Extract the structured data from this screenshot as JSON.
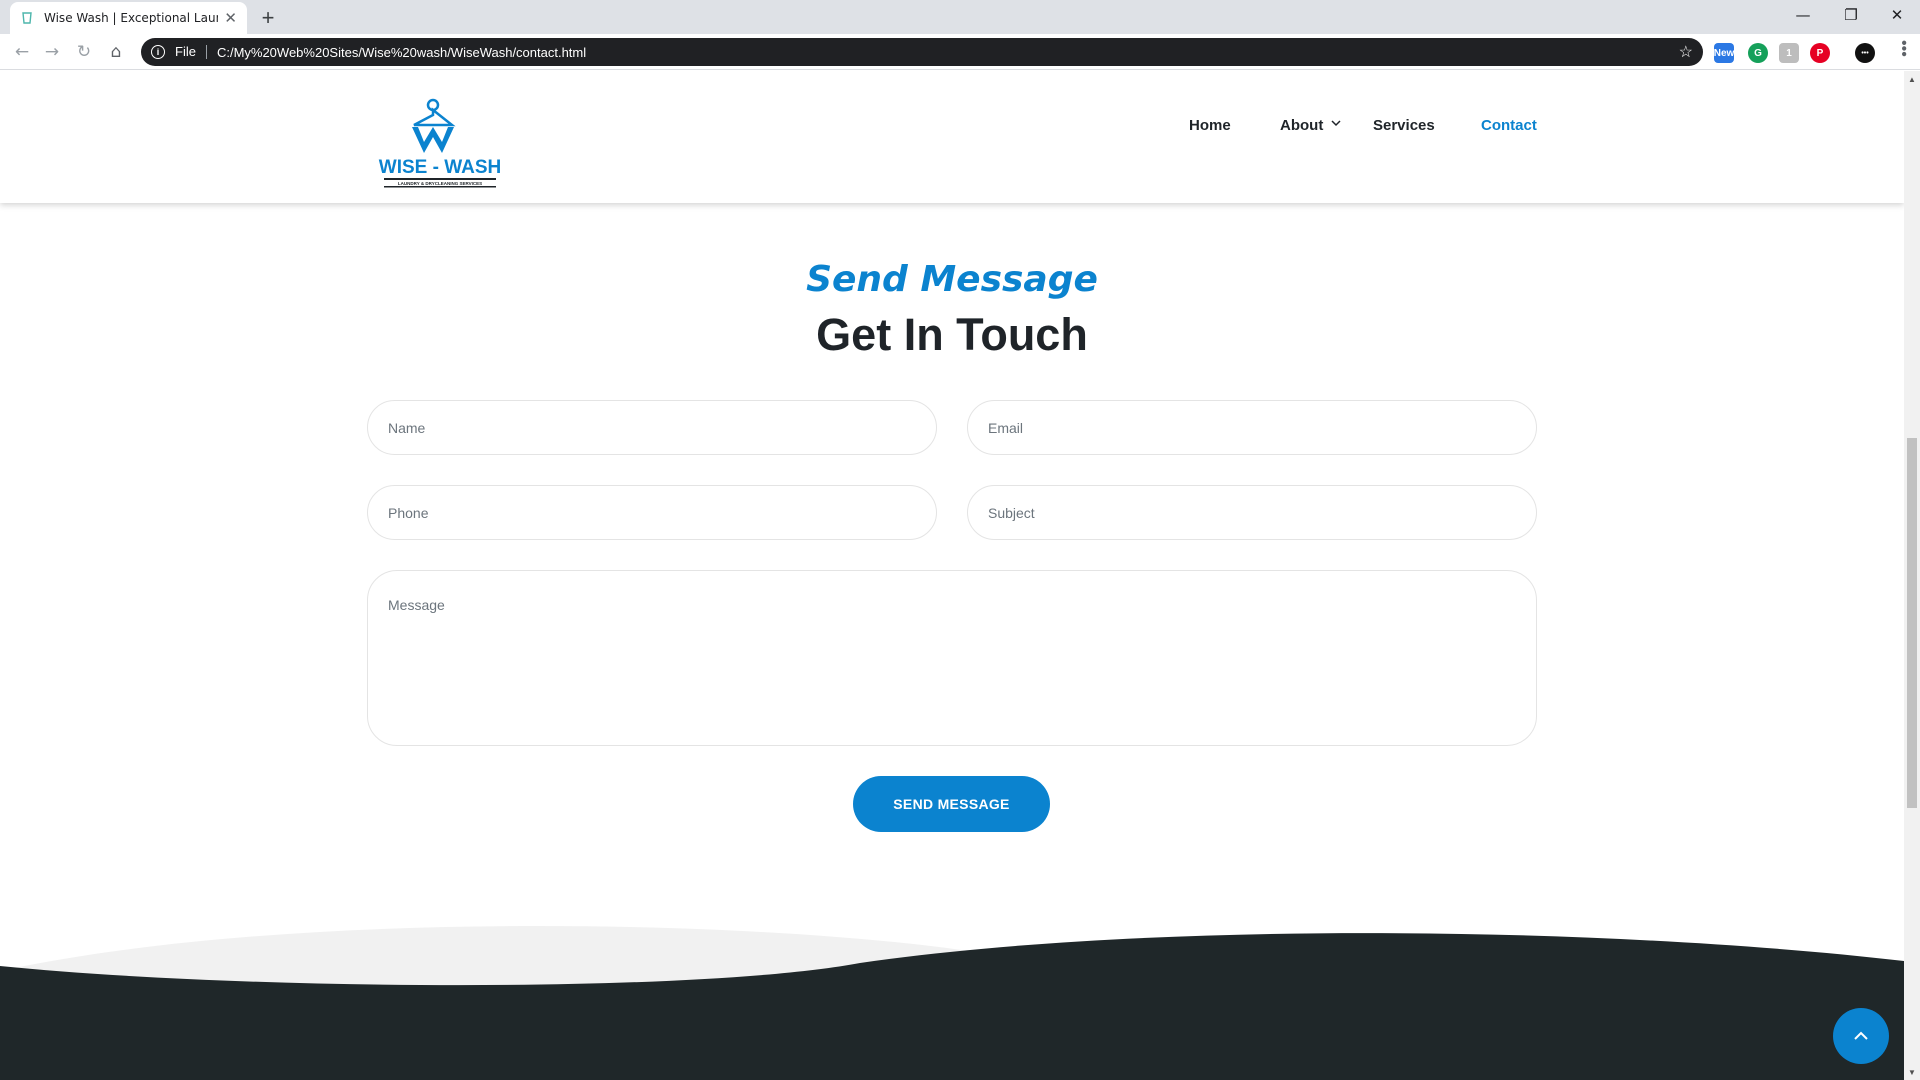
{
  "browser": {
    "tab_title": "Wise Wash | Exceptional Laundry",
    "tab_close": "✕",
    "new_tab": "+",
    "window_controls": {
      "minimize": "—",
      "restore": "❐",
      "close": "✕"
    },
    "nav": {
      "back": "←",
      "forward": "→",
      "reload": "↻",
      "home": "⌂"
    },
    "scheme_label": "File",
    "url": "C:/My%20Web%20Sites/Wise%20wash/WiseWash/contact.html",
    "bookmark": "☆",
    "menu": "•••",
    "extensions": [
      {
        "name": "news-extension",
        "label": "New",
        "color": "#2b78e4"
      },
      {
        "name": "grammarly-extension",
        "label": "G",
        "color": "#15a05a"
      },
      {
        "name": "puzzle-extension",
        "label": "1",
        "color": "#bdbdbd"
      },
      {
        "name": "pinterest-extension",
        "label": "P",
        "color": "#e60023"
      },
      {
        "name": "profile-extension",
        "label": "•••",
        "color": "#111111"
      }
    ]
  },
  "site": {
    "logo": {
      "text": "WISE - WASH",
      "tagline": "LAUNDRY & DRYCLEANING SERVICES"
    },
    "nav": [
      {
        "label": "Home",
        "active": false
      },
      {
        "label": "About",
        "active": false,
        "dropdown": true
      },
      {
        "label": "Services",
        "active": false
      },
      {
        "label": "Contact",
        "active": true
      }
    ],
    "section": {
      "subtitle": "Send Message",
      "title": "Get In Touch"
    },
    "form": {
      "name_placeholder": "Name",
      "email_placeholder": "Email",
      "phone_placeholder": "Phone",
      "subject_placeholder": "Subject",
      "message_placeholder": "Message",
      "submit_label": "SEND MESSAGE"
    },
    "back_to_top": "⌃"
  },
  "colors": {
    "accent": "#0b83cf",
    "heading": "#1f2429",
    "footer": "#1f2729",
    "wave_light": "#f1f1f1"
  }
}
